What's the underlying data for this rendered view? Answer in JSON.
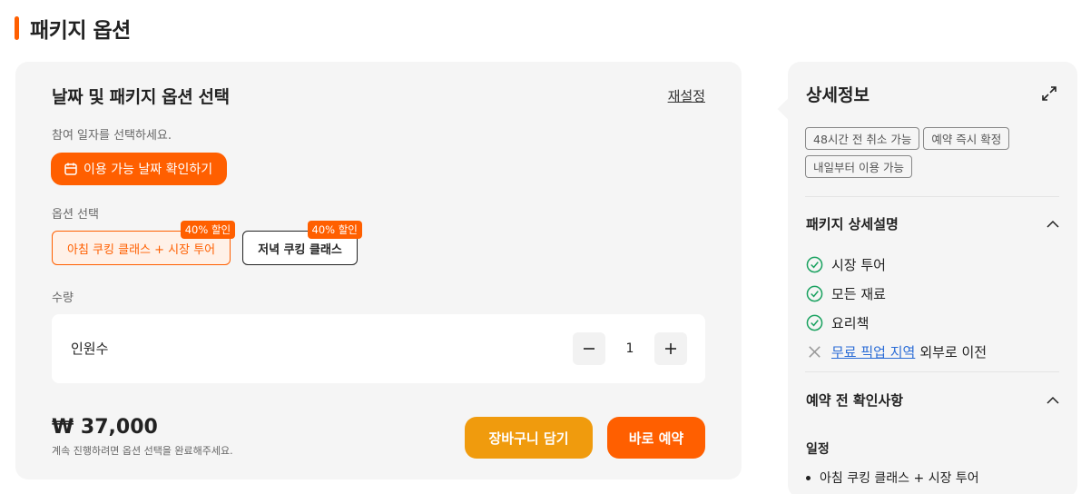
{
  "section": {
    "title": "패키지 옵션"
  },
  "booking": {
    "heading": "날짜 및 패키지 옵션 선택",
    "reset_label": "재설정",
    "date_hint": "참여 일자를 선택하세요.",
    "date_button_label": "이용 가능 날짜 확인하기",
    "options_label": "옵션 선택",
    "options": [
      {
        "label": "아침 쿠킹 클래스 + 시장 투어",
        "badge": "40% 할인",
        "selected": true
      },
      {
        "label": "저녁 쿠킹 클래스",
        "badge": "40% 할인",
        "selected": false
      }
    ],
    "quantity_label": "수량",
    "quantity": {
      "name": "인원수",
      "value": "1"
    },
    "price": "₩ 37,000",
    "price_note": "계속 진행하려면 옵션 선택을 완료해주세요.",
    "cart_label": "장바구니 담기",
    "book_label": "바로 예약"
  },
  "details": {
    "title": "상세정보",
    "tags": [
      "48시간 전 취소 가능",
      "예약 즉시 확정",
      "내일부터 이용 가능"
    ],
    "package_heading": "패키지 상세설명",
    "included": [
      "시장 투어",
      "모든 재료",
      "요리책"
    ],
    "excluded": {
      "link": "무료 픽업 지역",
      "suffix": "외부로 이전"
    },
    "prebook_heading": "예약 전 확인사항",
    "schedule_label": "일정",
    "schedule_items": [
      "아침 쿠킹 클래스 + 시장 투어"
    ]
  },
  "colors": {
    "accent": "#ff5f00",
    "cart": "#f09b0d",
    "check": "#1aa260",
    "link": "#2a6cd6"
  }
}
